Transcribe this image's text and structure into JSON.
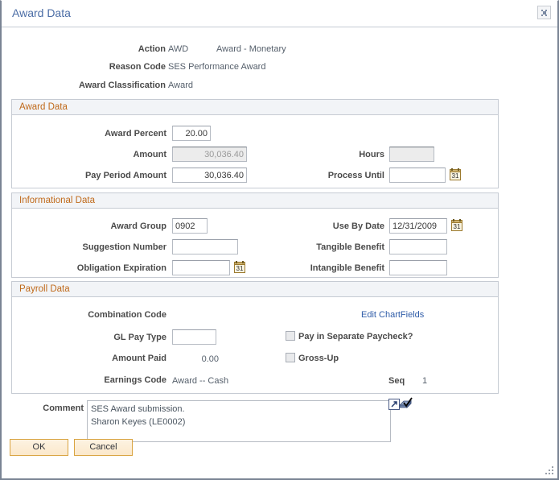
{
  "window": {
    "title": "Award Data",
    "close_icon": "close-icon"
  },
  "header": {
    "action_label": "Action",
    "action_code": "AWD",
    "action_description": "Award - Monetary",
    "reason_code_label": "Reason Code",
    "reason_code_value": "SES Performance Award",
    "award_classification_label": "Award Classification",
    "award_classification_value": "Award"
  },
  "award_data": {
    "section_title": "Award Data",
    "award_percent_label": "Award Percent",
    "award_percent_value": "20.00",
    "amount_label": "Amount",
    "amount_value": "30,036.40",
    "pay_period_amount_label": "Pay Period Amount",
    "pay_period_amount_value": "30,036.40",
    "hours_label": "Hours",
    "hours_value": "",
    "process_until_label": "Process Until",
    "process_until_value": "",
    "calendar_icon": "calendar-icon"
  },
  "informational_data": {
    "section_title": "Informational Data",
    "award_group_label": "Award Group",
    "award_group_value": "0902",
    "suggestion_number_label": "Suggestion Number",
    "suggestion_number_value": "",
    "obligation_expiration_label": "Obligation Expiration",
    "obligation_expiration_value": "",
    "use_by_date_label": "Use By Date",
    "use_by_date_value": "12/31/2009",
    "tangible_benefit_label": "Tangible Benefit",
    "tangible_benefit_value": "",
    "intangible_benefit_label": "Intangible Benefit",
    "intangible_benefit_value": ""
  },
  "payroll_data": {
    "section_title": "Payroll Data",
    "combination_code_label": "Combination Code",
    "combination_code_value": "",
    "edit_chartfields_link": "Edit ChartFields",
    "gl_pay_type_label": "GL Pay Type",
    "gl_pay_type_value": "",
    "pay_separate_label": "Pay in Separate Paycheck?",
    "pay_separate_checked": false,
    "amount_paid_label": "Amount Paid",
    "amount_paid_value": "0.00",
    "gross_up_label": "Gross-Up",
    "gross_up_checked": false,
    "earnings_code_label": "Earnings Code",
    "earnings_code_value": "Award -- Cash",
    "seq_label": "Seq",
    "seq_value": "1"
  },
  "comment": {
    "label": "Comment",
    "value": "SES Award submission.\nSharon Keyes (LE0002)",
    "expand_icon": "expand-popup-icon",
    "spellcheck_icon": "spellcheck-icon"
  },
  "footer": {
    "ok_label": "OK",
    "cancel_label": "Cancel"
  },
  "colors": {
    "title": "#4b6da6",
    "section_header_text": "#c06a1b",
    "section_header_bg": "#f2f4f7",
    "link": "#2f5ca8",
    "button_border": "#d9a441",
    "label": "#4a4a4a"
  }
}
